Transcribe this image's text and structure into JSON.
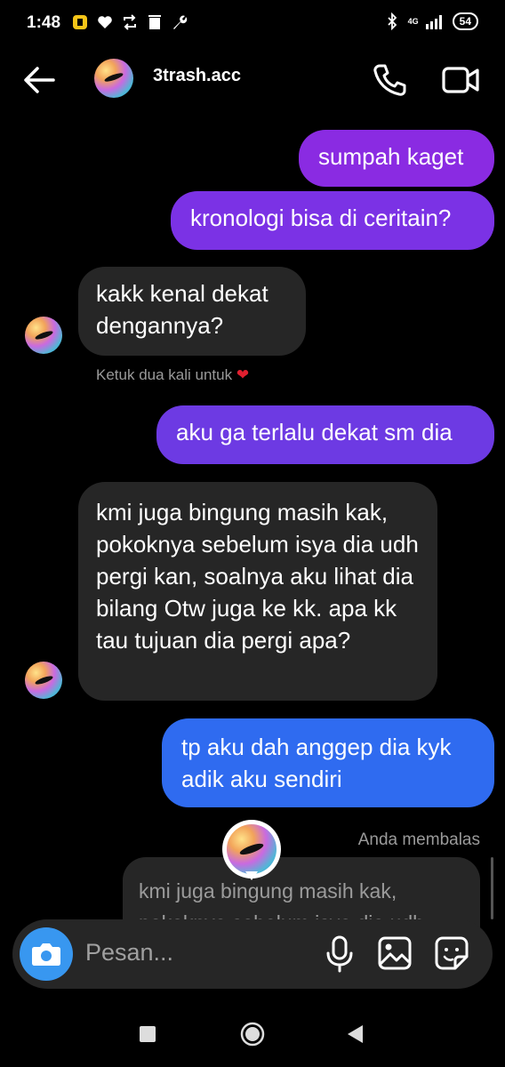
{
  "status_bar": {
    "time": "1:48",
    "battery": "54",
    "network": "4G"
  },
  "header": {
    "username": "3trash.acc"
  },
  "messages": [
    {
      "text": "sumpah kaget"
    },
    {
      "text": "kronologi bisa di ceritain?"
    },
    {
      "text": "kakk kenal dekat dengannya?"
    },
    {
      "text": "aku ga terlalu dekat sm dia"
    },
    {
      "text": "kmi juga bingung masih kak, pokoknya sebelum isya dia udh pergi kan, soalnya aku lihat dia bilang Otw juga ke kk. apa kk tau tujuan dia pergi apa?"
    },
    {
      "text": "tp aku dah anggep dia kyk adik aku sendiri"
    }
  ],
  "double_tap_hint": "Ketuk dua kali untuk",
  "reply": {
    "label": "Anda membalas",
    "quote": "kmi juga bingung masih kak, pokoknya sebelum isya dia udh pergi kan"
  },
  "composer": {
    "placeholder": "Pesan..."
  },
  "colors": {
    "purple_bubble": "#8a2be2",
    "violet_bubble": "#6d3ae3",
    "blue_bubble": "#2f6bf0",
    "incoming_bubble": "#262626",
    "camera_button": "#3897f0",
    "heart": "#e01f2f"
  },
  "icons": [
    "back-arrow-icon",
    "phone-icon",
    "video-icon",
    "camera-icon",
    "mic-icon",
    "gallery-icon",
    "sticker-icon",
    "heart-icon"
  ]
}
